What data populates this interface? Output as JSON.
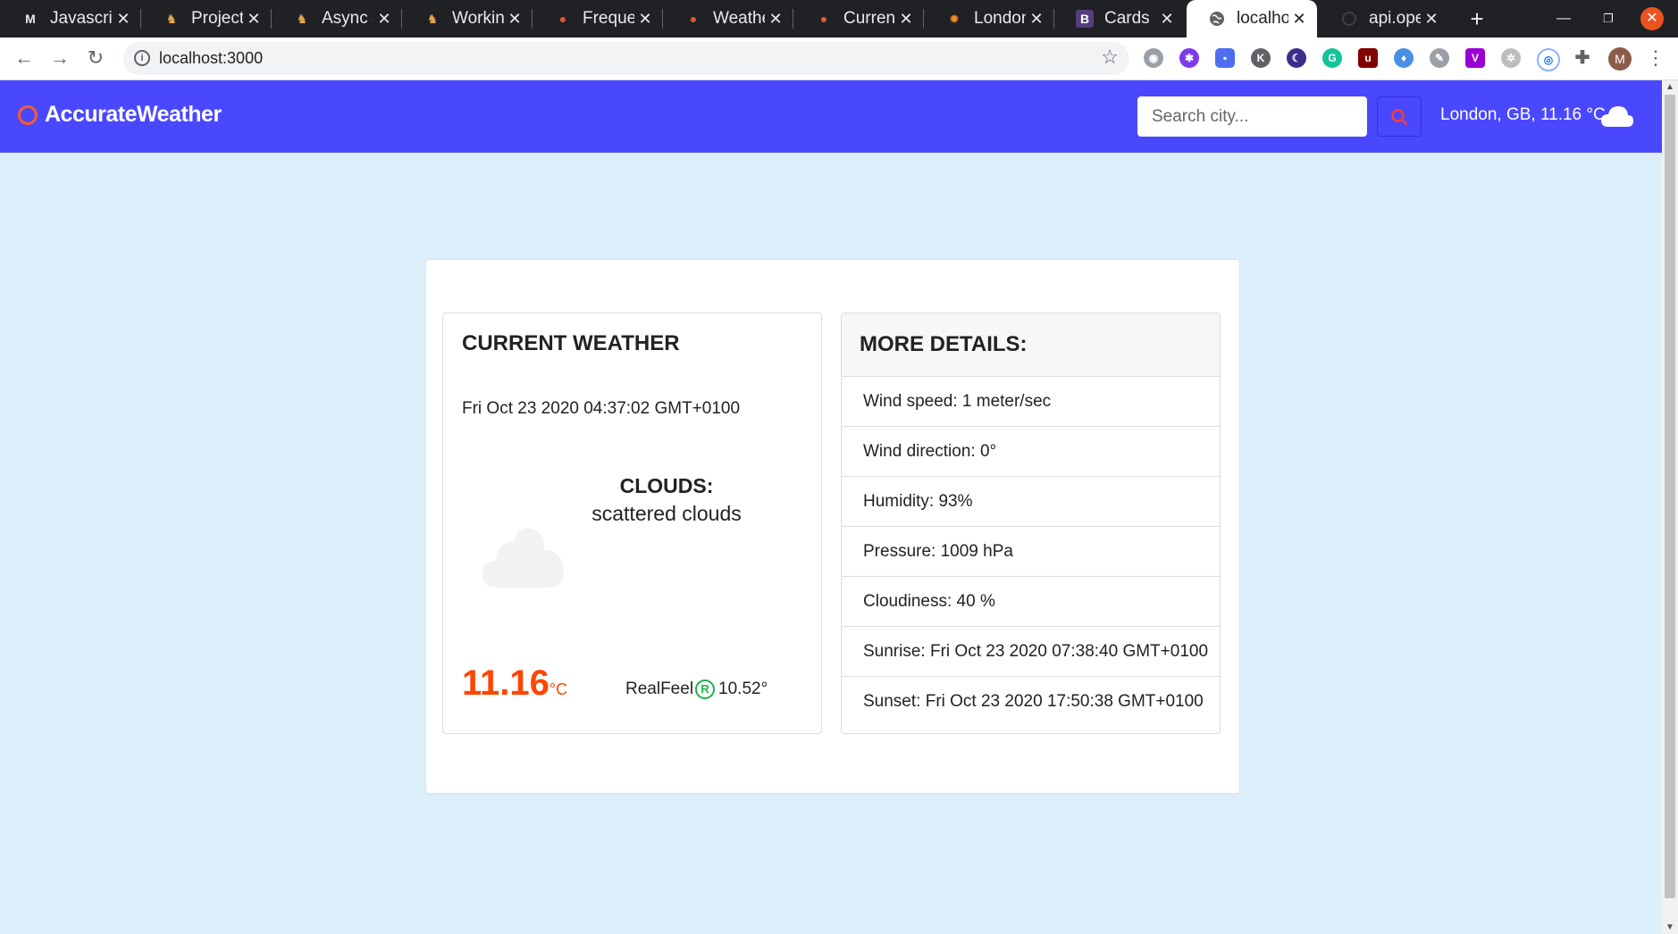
{
  "browser": {
    "tabs": [
      {
        "title": "Javascri",
        "favicon": "m-icon"
      },
      {
        "title": "Project:",
        "favicon": "fox-icon"
      },
      {
        "title": "Async a",
        "favicon": "fox-icon"
      },
      {
        "title": "Working",
        "favicon": "fox-icon"
      },
      {
        "title": "Frequer",
        "favicon": "weather-icon"
      },
      {
        "title": "Weathe",
        "favicon": "weather-icon"
      },
      {
        "title": "Current",
        "favicon": "weather-icon"
      },
      {
        "title": "London",
        "favicon": "sun-icon"
      },
      {
        "title": "Cards · I",
        "favicon": "bootstrap-icon"
      },
      {
        "title": "localhos",
        "favicon": "globe-icon"
      },
      {
        "title": "api.oper",
        "favicon": "loading-icon"
      }
    ],
    "url": "localhost:3000",
    "profile_initial": "M"
  },
  "app": {
    "brand": "AccurateWeather",
    "search_placeholder": "Search city...",
    "location_summary": "London, GB, 11.16 °C"
  },
  "current": {
    "title": "CURRENT WEATHER",
    "date": "Fri Oct 23 2020 04:37:02 GMT+0100",
    "condition_label": "CLOUDS:",
    "condition_text": "scattered clouds",
    "temp": "11.16",
    "temp_unit": "°C",
    "realfeel_label": "RealFeel",
    "realfeel_symbol": "R",
    "realfeel_value": "10.52°"
  },
  "details": {
    "title": "MORE DETAILS:",
    "items": [
      "Wind speed: 1 meter/sec",
      "Wind direction: 0°",
      "Humidity: 93%",
      "Pressure: 1009 hPa",
      "Cloudiness: 40 %",
      "Sunrise: Fri Oct 23 2020 07:38:40 GMT+0100",
      "Sunset: Fri Oct 23 2020 17:50:38 GMT+0100"
    ]
  },
  "colors": {
    "navbar": "#4a48ff",
    "page_bg": "#ddeefb",
    "temp": "#ff4500",
    "accent_logo": "#ff5a2a"
  }
}
